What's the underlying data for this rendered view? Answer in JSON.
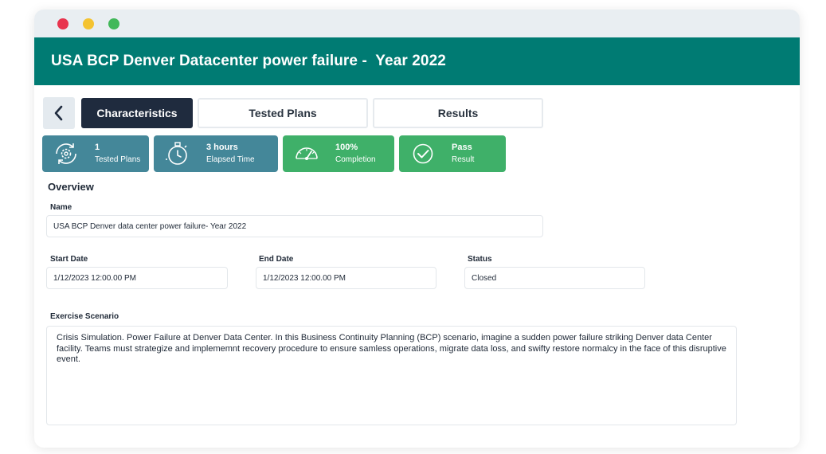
{
  "header": {
    "title": "USA BCP Denver Datacenter power failure -  Year 2022"
  },
  "tabs": [
    {
      "label": "Characteristics",
      "active": true
    },
    {
      "label": "Tested Plans",
      "active": false
    },
    {
      "label": "Results",
      "active": false
    }
  ],
  "stats": [
    {
      "value": "1",
      "label": "Tested Plans",
      "icon": "gear-cycle-icon",
      "color": "#448799"
    },
    {
      "value": "3 hours",
      "label": "Elapsed Time",
      "icon": "stopwatch-icon",
      "color": "#448799"
    },
    {
      "value": "100%",
      "label": "Completion",
      "icon": "gauge-icon",
      "color": "#3fb069"
    },
    {
      "value": "Pass",
      "label": "Result",
      "icon": "check-circle-icon",
      "color": "#3fb069"
    }
  ],
  "overview": {
    "title": "Overview",
    "name_label": "Name",
    "name_value": "USA BCP Denver data center power failure- Year 2022",
    "start_label": "Start Date",
    "start_value": "1/12/2023 12:00.00 PM",
    "end_label": "End Date",
    "end_value": "1/12/2023 12:00.00 PM",
    "status_label": "Status",
    "status_value": "Closed",
    "scenario_label": "Exercise Scenario",
    "scenario_value": "Crisis Simulation. Power Failure at Denver Data Center. In this Business Continuity Planning (BCP) scenario, imagine a sudden power failure striking Denver data Center facility. Teams must strategize and implememnt recovery procedure to ensure samless operations, migrate data loss, and swifty restore normalcy in the face of this disruptive event."
  },
  "colors": {
    "header": "#007b73",
    "active_tab": "#1f2b3e",
    "stat_blue": "#448799",
    "stat_green": "#3fb069"
  }
}
